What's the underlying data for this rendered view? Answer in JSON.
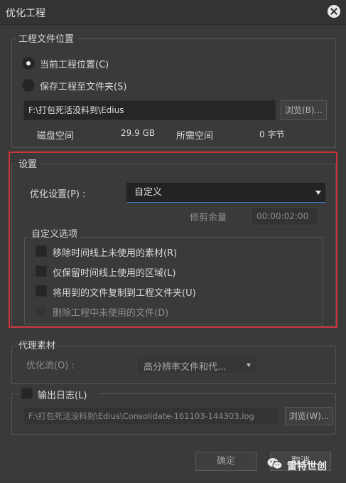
{
  "dialog": {
    "title": "优化工程"
  },
  "location": {
    "group_title": "工程文件位置",
    "option_current": "当前工程位置(C)",
    "option_save_folder": "保存工程至文件夹(S)",
    "path": "F:\\打包死活没料到\\Edius",
    "browse_label": "浏览(B)...",
    "disk_space_label": "磁盘空间",
    "disk_space_value": "29.9 GB",
    "required_space_label": "所需空间",
    "required_space_value": "0 字节"
  },
  "settings": {
    "group_title": "设置",
    "optimize_label": "优化设置(P) :",
    "optimize_value": "自定义",
    "trim_margin_label": "修剪余量",
    "trim_margin_value": "00:00:02:00",
    "custom_title": "自定义选项",
    "options": [
      {
        "label": "移除时间线上未使用的素材(R)",
        "checked": false,
        "enabled": true
      },
      {
        "label": "仅保留时间线上使用的区域(L)",
        "checked": false,
        "enabled": true
      },
      {
        "label": "将用到的文件复制到工程文件夹(U)",
        "checked": false,
        "enabled": true
      },
      {
        "label": "删除工程中未使用的文件(D)",
        "checked": false,
        "enabled": false
      }
    ]
  },
  "proxy": {
    "group_title": "代理素材",
    "flow_label": "优化流(O) :",
    "flow_value": "高分辨率文件和代..."
  },
  "log": {
    "checkbox_label": "输出日志(L)",
    "path": "F:\\打包死活没料到\\Edius\\Consolidate-161103-144303.log",
    "browse_label": "浏览(W)..."
  },
  "footer": {
    "ok_label": "确定",
    "cancel_label": "取消"
  },
  "watermark": {
    "text": "雷特世创"
  },
  "colors": {
    "highlight_border": "#c9343a",
    "focus_underline": "#3b7bd0"
  }
}
